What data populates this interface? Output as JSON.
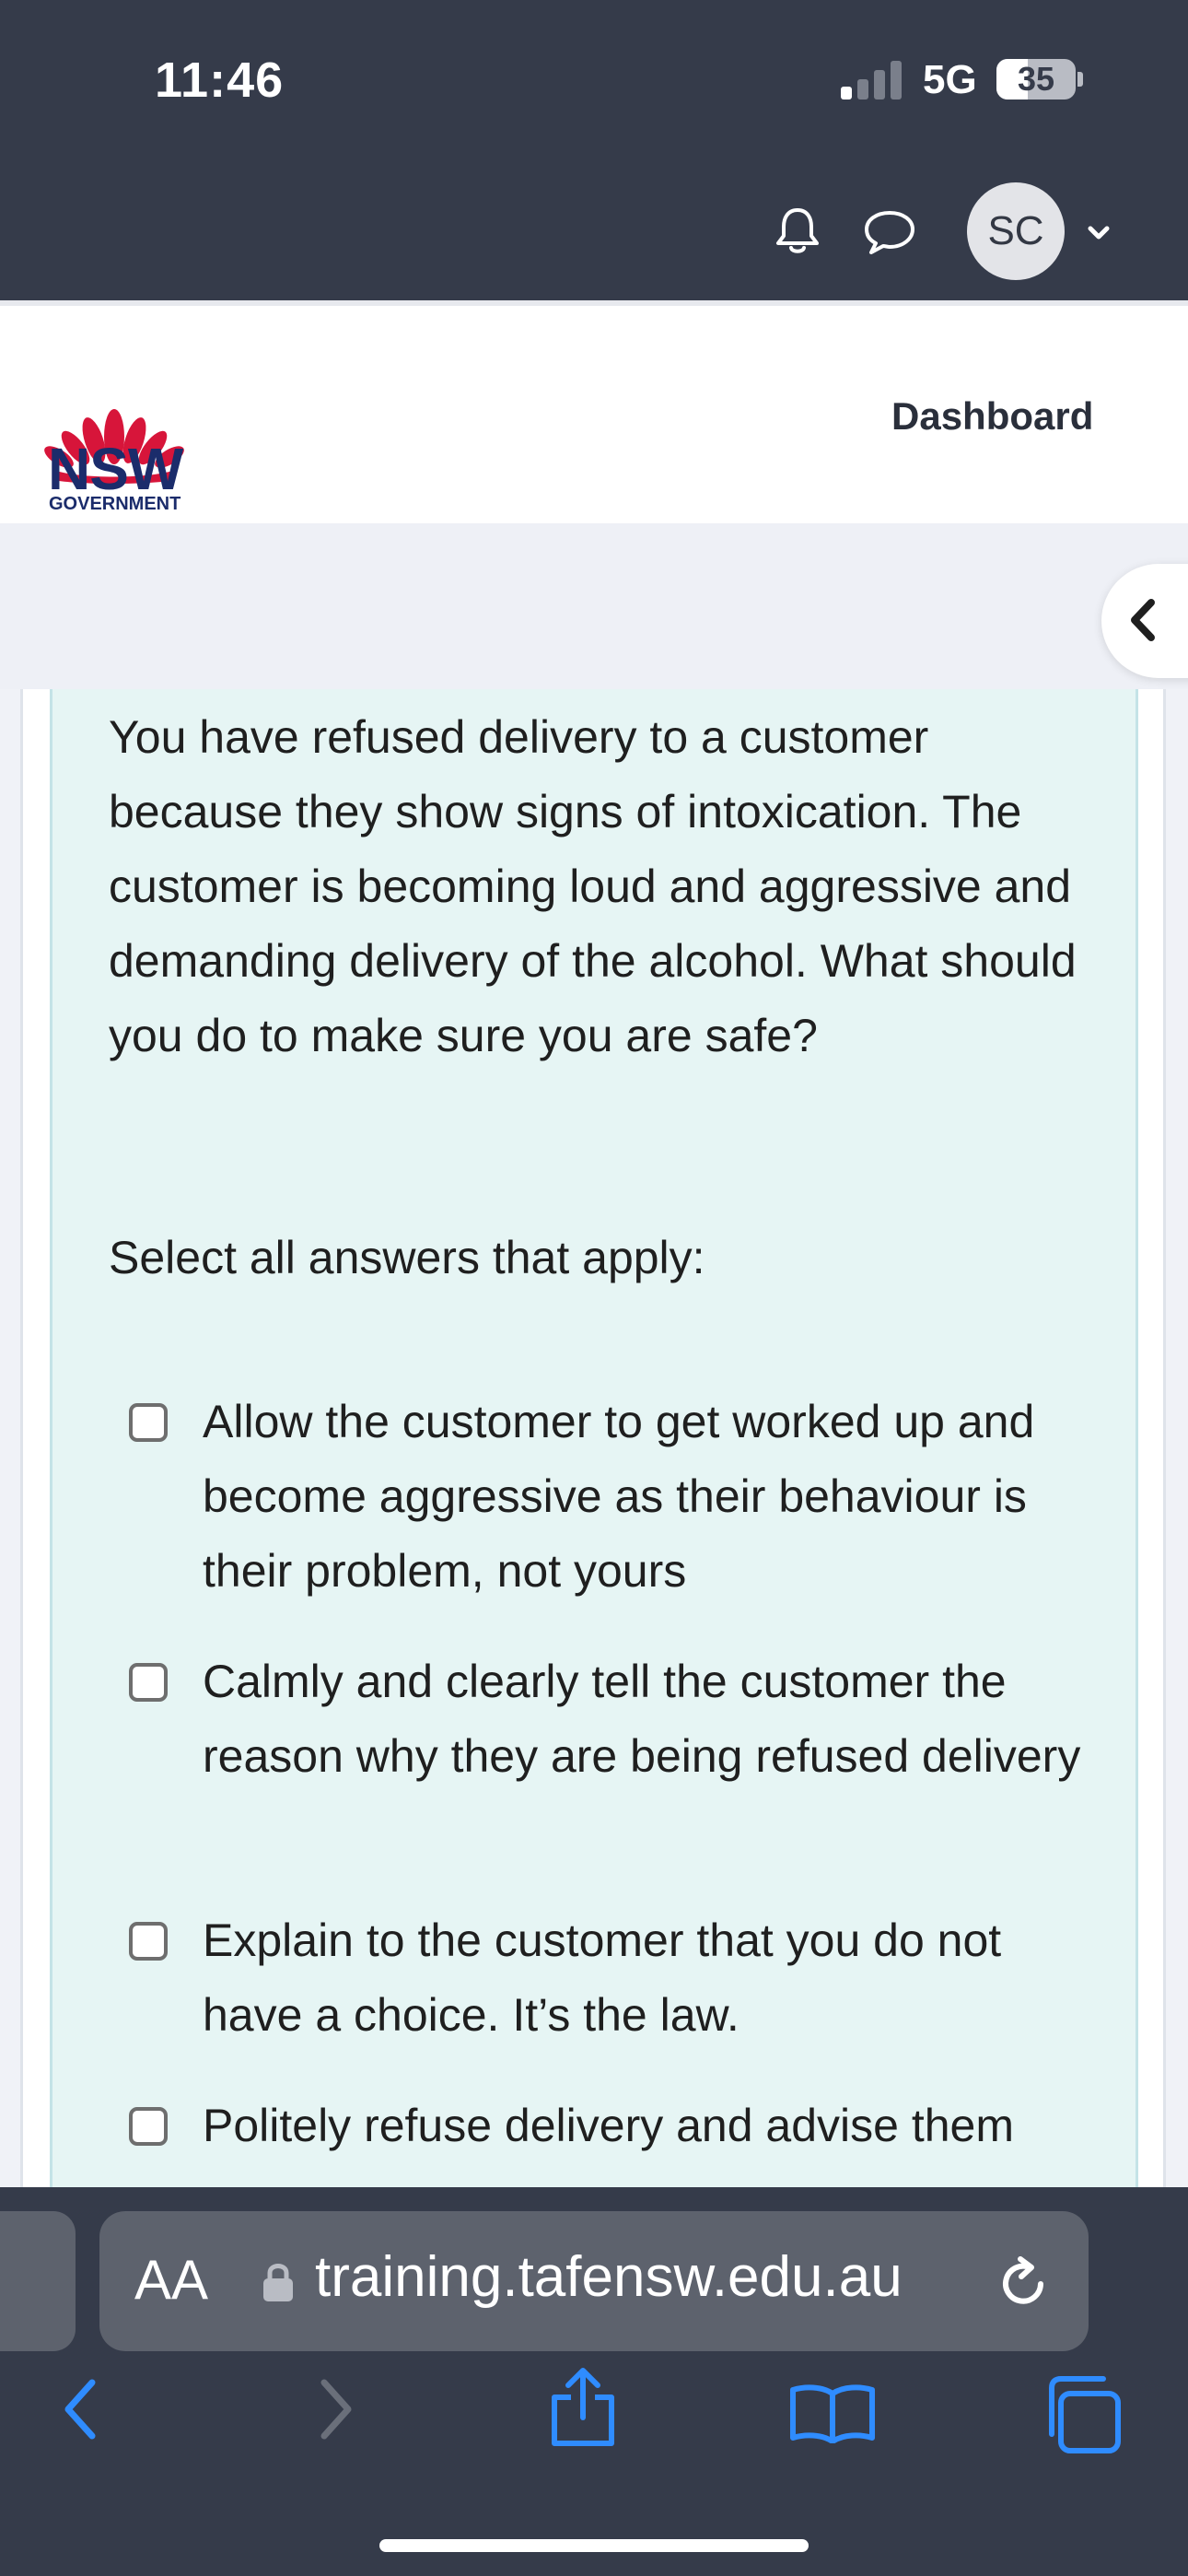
{
  "status_bar": {
    "time": "11:46",
    "network": "5G",
    "battery": "35"
  },
  "app_bar": {
    "avatar_initials": "SC"
  },
  "header": {
    "logo_text": "NSW",
    "logo_subtext": "GOVERNMENT",
    "nav_link": "Dashboard"
  },
  "quiz": {
    "question": "You have refused delivery to a customer because they show signs of intoxication. The customer is becoming loud and aggressive and demanding delivery of the alcohol. What should you do to make sure you are safe?",
    "instruction": "Select all answers that apply:",
    "options": [
      {
        "label": "Allow the customer to get worked up and become aggressive as their behaviour is their problem, not yours",
        "checked": false
      },
      {
        "label": "Calmly and clearly tell the customer the reason why they are being refused delivery",
        "checked": false
      },
      {
        "label": "Explain to the customer that you do not have a choice. It’s the law.",
        "checked": false
      },
      {
        "label": "Politely refuse delivery and advise them",
        "checked": false
      }
    ]
  },
  "browser": {
    "text_size_label": "AA",
    "url": "training.tafensw.edu.au"
  },
  "colors": {
    "app_bar": "#353b4a",
    "card_background": "#e6f5f4",
    "browser_accent": "#2f8cff",
    "nsw_red": "#d7153a",
    "nsw_navy": "#1b2c6b"
  }
}
